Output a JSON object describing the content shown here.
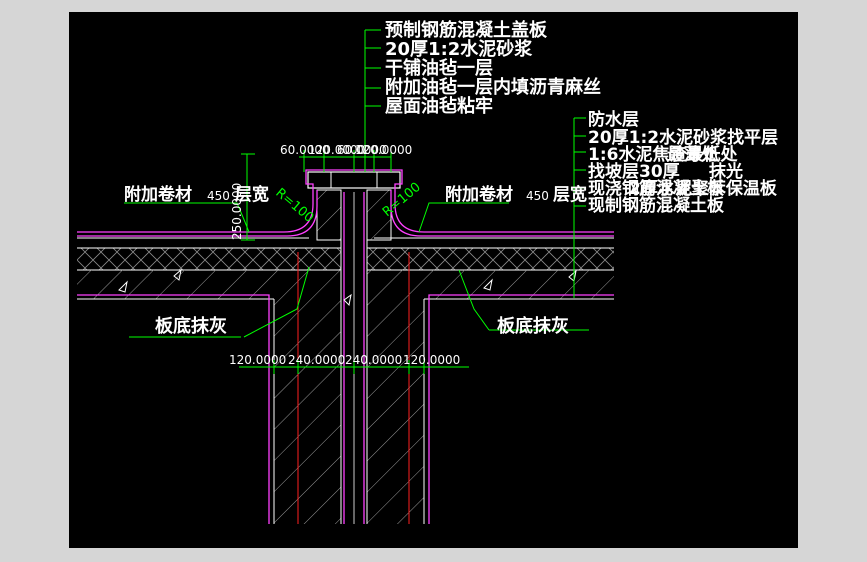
{
  "colors": {
    "background": "#000000",
    "frame": "#d6d6d6",
    "structure": "#ffffff",
    "membrane": "#ff40ff",
    "leader": "#00ff00",
    "centerline": "#ff2020",
    "hatch": "#9a9a9a"
  },
  "labels": {
    "top_layers": [
      "预制钢筋混凝土盖板",
      "20厚1:2水泥砂浆",
      "干铺油毡一层",
      "附加油毡一层内填沥青麻丝",
      "屋面油毡粘牢"
    ],
    "right_layers": [
      "防水层",
      "20厚1:2水泥砂浆找平层",
      "1:6水泥焦渣最低处",
      "找坡层30厚",
      "现浇钢筋混凝土板",
      "现制钢筋混凝土板"
    ],
    "right_layers_overlap": [
      "最薄处",
      "抹光",
      "2厚水泥聚苯保温板"
    ],
    "left_roll": "附加卷材",
    "left_roll_width": "450",
    "left_roll_suffix": "层宽",
    "right_roll": "附加卷材",
    "right_roll_width": "450",
    "right_roll_suffix": "层宽",
    "left_plaster": "板底抹灰",
    "right_plaster": "板底抹灰",
    "radius_left": "R=100",
    "radius_right": "R=100"
  },
  "dimensions": {
    "top_row": [
      "60.0000",
      "120.0000",
      "60.0000",
      "120.0000"
    ],
    "vertical": "250.0000",
    "bottom_row": [
      "120.0000",
      "240.0000",
      "240.0000",
      "120.0000"
    ]
  }
}
